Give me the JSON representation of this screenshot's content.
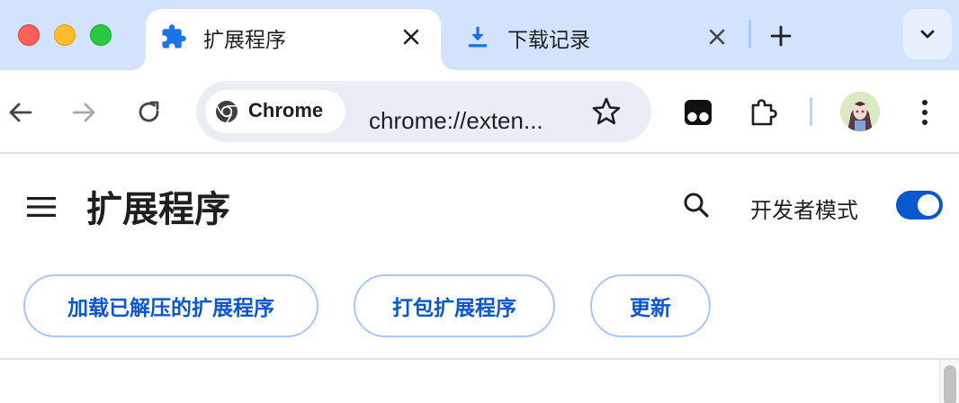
{
  "tabs": [
    {
      "title": "扩展程序",
      "icon": "puzzle-icon",
      "active": true
    },
    {
      "title": "下载记录",
      "icon": "download-icon",
      "active": false
    }
  ],
  "omnibox": {
    "chip_label": "Chrome",
    "url": "chrome://exten..."
  },
  "page": {
    "title": "扩展程序",
    "developer_mode_label": "开发者模式",
    "developer_mode_on": true
  },
  "actions": {
    "load_unpacked": "加载已解压的扩展程序",
    "pack": "打包扩展程序",
    "update": "更新"
  },
  "colors": {
    "tabstrip_bg": "#d3e3fd",
    "accent": "#0b57d0",
    "button_border": "#a8c7fa",
    "omnibox_bg": "#e9eef6"
  }
}
